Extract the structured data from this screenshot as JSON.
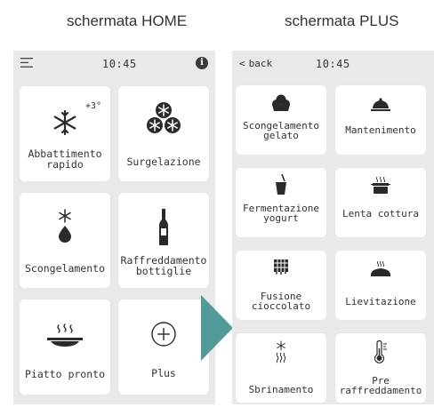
{
  "captions": {
    "home": "schermata HOME",
    "plus": "schermata PLUS"
  },
  "home": {
    "time": "10:45",
    "tiles": [
      {
        "label": "Abbattimento rapido",
        "badge": "+3°"
      },
      {
        "label": "Surgelazione"
      },
      {
        "label": "Scongelamento"
      },
      {
        "label": "Raffreddamento bottiglie"
      },
      {
        "label": "Piatto pronto"
      },
      {
        "label": "Plus"
      }
    ]
  },
  "plus": {
    "back_label": "back",
    "time": "10:45",
    "tiles": [
      {
        "label": "Scongelamento gelato"
      },
      {
        "label": "Mantenimento"
      },
      {
        "label": "Fermentazione yogurt"
      },
      {
        "label": "Lenta cottura"
      },
      {
        "label": "Fusione cioccolato"
      },
      {
        "label": "Lievitazione"
      },
      {
        "label": "Sbrinamento"
      },
      {
        "label": "Pre raffreddamento"
      }
    ]
  },
  "colors": {
    "arrow": "#539a9b",
    "screen_bg": "#e9e9e9",
    "tile_bg": "#ffffff",
    "icon": "#2a2a2a"
  },
  "icons": [
    "menu-icon",
    "info-icon",
    "snowflake-icon",
    "snowflakes-cluster-icon",
    "thaw-icon",
    "bottle-icon",
    "plate-icon",
    "plus-circle-icon",
    "ice-cream-icon",
    "cloche-icon",
    "yogurt-cup-icon",
    "pot-icon",
    "chocolate-icon",
    "bread-icon",
    "defrost-icon",
    "thermometer-icon"
  ]
}
